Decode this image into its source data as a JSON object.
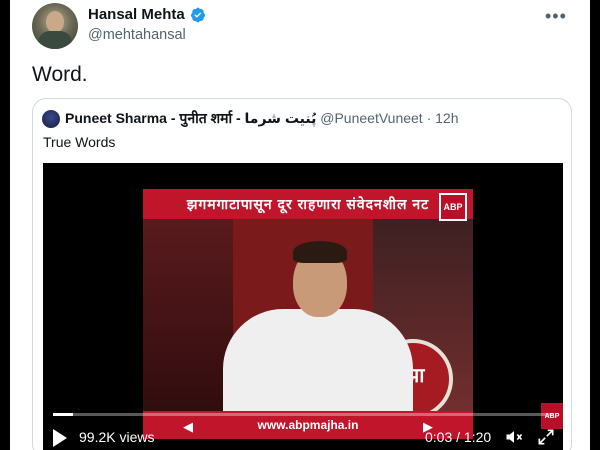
{
  "author": {
    "name": "Hansal Mehta",
    "handle": "@mehtahansal",
    "verified": true
  },
  "tweet_text": "Word.",
  "more_icon": "more-horizontal-icon",
  "quoted": {
    "name": "Puneet Sharma - पुनीत शर्मा - پُنیت شرما",
    "handle": "@PuneetVuneet",
    "separator": "·",
    "time": "12h",
    "text": "True Words"
  },
  "video": {
    "banner_text": "झगमगाटापासून दूर राहणारा संवेदनशील नट",
    "logo_text": "ABP",
    "circle_text": "माझा",
    "ticker_text": "www.abpmajha.in",
    "ticker_arrow_left": "◀",
    "ticker_arrow_right": "▶",
    "corner_logo_text": "ABP",
    "views": "99.2K views",
    "time": "0:03 / 1:20",
    "progress_fraction": 0.04,
    "icons": [
      "play-icon",
      "mute-icon",
      "expand-icon"
    ]
  },
  "colors": {
    "accent": "#1d9bf0",
    "secondary_text": "#536471",
    "abp_red": "#c0152a"
  }
}
